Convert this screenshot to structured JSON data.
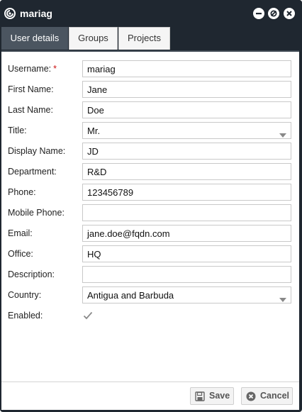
{
  "window": {
    "title": "mariag",
    "icon": "app-logo-icon",
    "controls": [
      "minimize-icon",
      "maximize-icon",
      "close-icon"
    ]
  },
  "tabs": [
    {
      "label": "User details",
      "active": true
    },
    {
      "label": "Groups",
      "active": false
    },
    {
      "label": "Projects",
      "active": false
    }
  ],
  "form": {
    "username": {
      "label": "Username:",
      "required_mark": "*",
      "value": "mariag"
    },
    "first_name": {
      "label": "First Name:",
      "value": "Jane"
    },
    "last_name": {
      "label": "Last Name:",
      "value": "Doe"
    },
    "title": {
      "label": "Title:",
      "value": "Mr."
    },
    "display_name": {
      "label": "Display Name:",
      "value": "JD"
    },
    "department": {
      "label": "Department:",
      "value": "R&D"
    },
    "phone": {
      "label": "Phone:",
      "value": "123456789"
    },
    "mobile_phone": {
      "label": "Mobile Phone:",
      "value": ""
    },
    "email": {
      "label": "Email:",
      "value": "jane.doe@fqdn.com"
    },
    "office": {
      "label": "Office:",
      "value": "HQ"
    },
    "description": {
      "label": "Description:",
      "value": ""
    },
    "country": {
      "label": "Country:",
      "value": "Antigua and Barbuda"
    },
    "enabled": {
      "label": "Enabled:",
      "checked": true
    }
  },
  "footer": {
    "save_label": "Save",
    "cancel_label": "Cancel"
  },
  "colors": {
    "titlebar": "#1f2730",
    "active_tab": "#4b5560",
    "required": "#cc1111"
  }
}
